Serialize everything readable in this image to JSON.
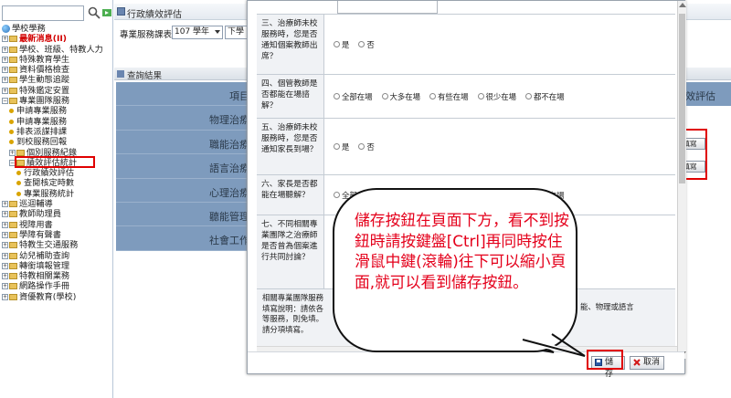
{
  "sidebar": {
    "search_placeholder": "",
    "items": [
      {
        "label": "學校學務",
        "icon": "globe-icon",
        "style": "normal",
        "indent": 0
      },
      {
        "label": "最新消息(II)",
        "icon": "plus",
        "style": "red",
        "indent": 0
      },
      {
        "label": "學校、班級、特教人力",
        "icon": "plus",
        "style": "normal",
        "indent": 0
      },
      {
        "label": "特殊教育學生",
        "icon": "plus",
        "style": "normal",
        "indent": 0
      },
      {
        "label": "資料價格檢查",
        "icon": "plus",
        "style": "normal",
        "indent": 0
      },
      {
        "label": "學生動態追蹤",
        "icon": "plus",
        "style": "normal",
        "indent": 0
      },
      {
        "label": "特殊鑑定安置",
        "icon": "plus",
        "style": "normal",
        "indent": 0
      },
      {
        "label": "專業團隊服務",
        "icon": "minus",
        "style": "normal",
        "indent": 0
      },
      {
        "label": "申請專業服務",
        "icon": "dot",
        "style": "normal",
        "indent": 1
      },
      {
        "label": "申請專業服務",
        "icon": "dot",
        "style": "normal",
        "indent": 1
      },
      {
        "label": "排表派謀排課",
        "icon": "dot",
        "style": "normal",
        "indent": 1
      },
      {
        "label": "到校服務回報",
        "icon": "dot",
        "style": "normal",
        "indent": 1
      },
      {
        "label": "個別服務紀錄",
        "icon": "plus",
        "style": "normal",
        "indent": 1
      },
      {
        "label": "績效評估統計",
        "icon": "minus",
        "style": "normal",
        "indent": 1
      },
      {
        "label": "行政績效評估",
        "icon": "dot",
        "style": "normal",
        "indent": 2
      },
      {
        "label": "查閱核定時數",
        "icon": "dot",
        "style": "normal",
        "indent": 2
      },
      {
        "label": "專業服務統計",
        "icon": "dot",
        "style": "normal",
        "indent": 2
      },
      {
        "label": "巡迴輔導",
        "icon": "plus",
        "style": "normal",
        "indent": 0
      },
      {
        "label": "教師助理員",
        "icon": "plus",
        "style": "normal",
        "indent": 0
      },
      {
        "label": "視障用書",
        "icon": "plus",
        "style": "normal",
        "indent": 0
      },
      {
        "label": "學障有聲書",
        "icon": "plus",
        "style": "normal",
        "indent": 0
      },
      {
        "label": "特教生交通服務",
        "icon": "plus",
        "style": "normal",
        "indent": 0
      },
      {
        "label": "幼兒補助查詢",
        "icon": "plus",
        "style": "normal",
        "indent": 0
      },
      {
        "label": "轉銜填報管理",
        "icon": "plus",
        "style": "normal",
        "indent": 0
      },
      {
        "label": "特教相關業務",
        "icon": "plus",
        "style": "normal",
        "indent": 0
      },
      {
        "label": "網路操作手冊",
        "icon": "plus",
        "style": "normal",
        "indent": 0
      },
      {
        "label": "資優教育(學校)",
        "icon": "plus",
        "style": "normal",
        "indent": 0
      }
    ]
  },
  "main": {
    "title": "行政績效評估",
    "filter_label": "專業服務課表",
    "year_value": "107 學年",
    "type_value": "下學",
    "result_title": "查詢結果",
    "bg_table_head": "項目",
    "bg_table_rows": [
      "物理治療",
      "職能治療",
      "語言治療",
      "心理治療",
      "聽能管理",
      "社會工作"
    ],
    "right_head": "績效評估",
    "fill_buttons": [
      "填寫",
      "填寫"
    ]
  },
  "popup": {
    "questions": [
      {
        "label": "三、治療師未校服務時，您是否通知個案教師出席？",
        "options": [
          "是",
          "否"
        ]
      },
      {
        "label": "四、個管教師是否都能在場諮解？",
        "options": [
          "全部在場",
          "大多在場",
          "有些在場",
          "很少在場",
          "都不在場"
        ]
      },
      {
        "label": "五、治療師未校服務時，您是否通知家長到場？",
        "options": [
          "是",
          "否"
        ]
      },
      {
        "label": "六、家長是否都能在場聽解？",
        "options": [
          "全部在場",
          "大多在場",
          "有些在場",
          "很少在場",
          "都不在場"
        ]
      },
      {
        "label": "七、不同相關專業團隊之治療師是否曾為個案進行共同討論？",
        "options": []
      }
    ],
    "note_lines": [
      "相關專業團隊服務",
      "填寫說明：請依各",
      "等服務，則免填。",
      "請分項填寫。"
    ],
    "note_tail_lines": [
      "能、物理或語言",
      ""
    ],
    "save_label": "儲存",
    "cancel_label": "取消"
  },
  "callout": {
    "text": "儲存按鈕在頁面下方，看不到按鈕時請按鍵盤[Ctrl]再同時按住滑鼠中鍵(滾輪)往下可以縮小頁面,就可以看到儲存按鈕。"
  },
  "colors": {
    "highlight": "#e00000",
    "callout_text": "#e4001b",
    "table_bg": "#7e9bbd"
  }
}
